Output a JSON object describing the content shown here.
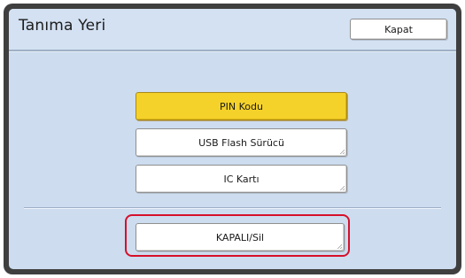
{
  "header": {
    "title": "Tanıma Yeri",
    "close_label": "Kapat"
  },
  "options": {
    "pin_label": "PIN Kodu",
    "usb_label": "USB Flash Sürücü",
    "ic_label": "IC Kartı",
    "selected": "PIN Kodu"
  },
  "footer": {
    "off_label": "KAPALI/Sil"
  },
  "colors": {
    "panel": "#cddcef",
    "frame": "#3f3f3f",
    "selected": "#f5d22a",
    "highlight": "#d6102a"
  }
}
